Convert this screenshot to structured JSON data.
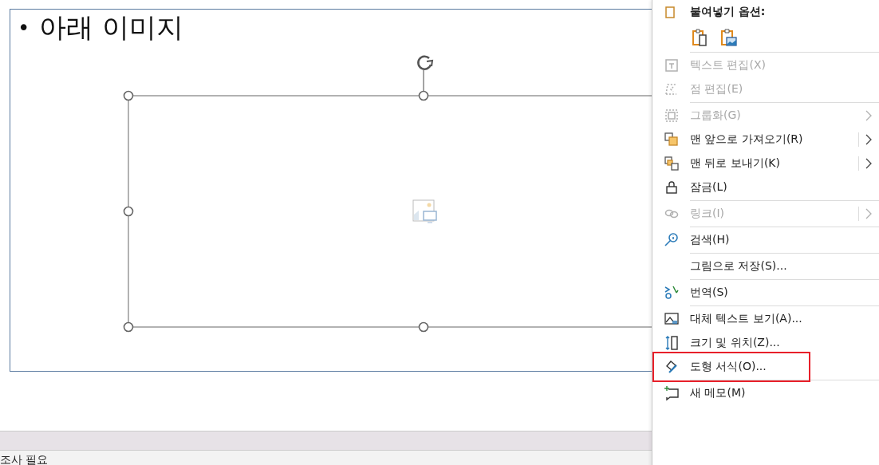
{
  "slide": {
    "bullet": "•",
    "title": "아래 이미지"
  },
  "context_menu": {
    "items": [
      {
        "kind": "header",
        "label": "붙여넣기 옵션:"
      },
      {
        "kind": "paste"
      },
      {
        "kind": "divider"
      },
      {
        "kind": "item",
        "label": "텍스트 편집(X)",
        "disabled": true,
        "submenu": false,
        "outlined": false
      },
      {
        "kind": "item",
        "label": "점 편집(E)",
        "disabled": true,
        "submenu": false,
        "outlined": false
      },
      {
        "kind": "divider"
      },
      {
        "kind": "item",
        "label": "그룹화(G)",
        "disabled": true,
        "submenu": true,
        "outlined": false
      },
      {
        "kind": "item",
        "label": "맨 앞으로 가져오기(R)",
        "disabled": false,
        "submenu": true,
        "outlined": false
      },
      {
        "kind": "item",
        "label": "맨 뒤로 보내기(K)",
        "disabled": false,
        "submenu": true,
        "outlined": false
      },
      {
        "kind": "item",
        "label": "잠금(L)",
        "disabled": false,
        "submenu": false,
        "outlined": false
      },
      {
        "kind": "divider"
      },
      {
        "kind": "item",
        "label": "링크(I)",
        "disabled": true,
        "submenu": true,
        "outlined": false
      },
      {
        "kind": "divider"
      },
      {
        "kind": "item",
        "label": "검색(H)",
        "disabled": false,
        "submenu": false,
        "outlined": false
      },
      {
        "kind": "divider"
      },
      {
        "kind": "item",
        "label": "그림으로 저장(S)...",
        "disabled": false,
        "submenu": false,
        "outlined": false
      },
      {
        "kind": "divider"
      },
      {
        "kind": "item",
        "label": "번역(S)",
        "disabled": false,
        "submenu": false,
        "outlined": false
      },
      {
        "kind": "divider"
      },
      {
        "kind": "item",
        "label": "대체 텍스트 보기(A)...",
        "disabled": false,
        "submenu": false,
        "outlined": false
      },
      {
        "kind": "item",
        "label": "크기 및 위치(Z)...",
        "disabled": false,
        "submenu": false,
        "outlined": false
      },
      {
        "kind": "item",
        "label": "도형 서식(O)...",
        "disabled": false,
        "submenu": false,
        "outlined": true
      },
      {
        "kind": "divider"
      },
      {
        "kind": "item",
        "label": "새 메모(M)",
        "disabled": false,
        "submenu": false,
        "outlined": false
      }
    ]
  },
  "status_bar": {
    "text": "조사 필요"
  }
}
